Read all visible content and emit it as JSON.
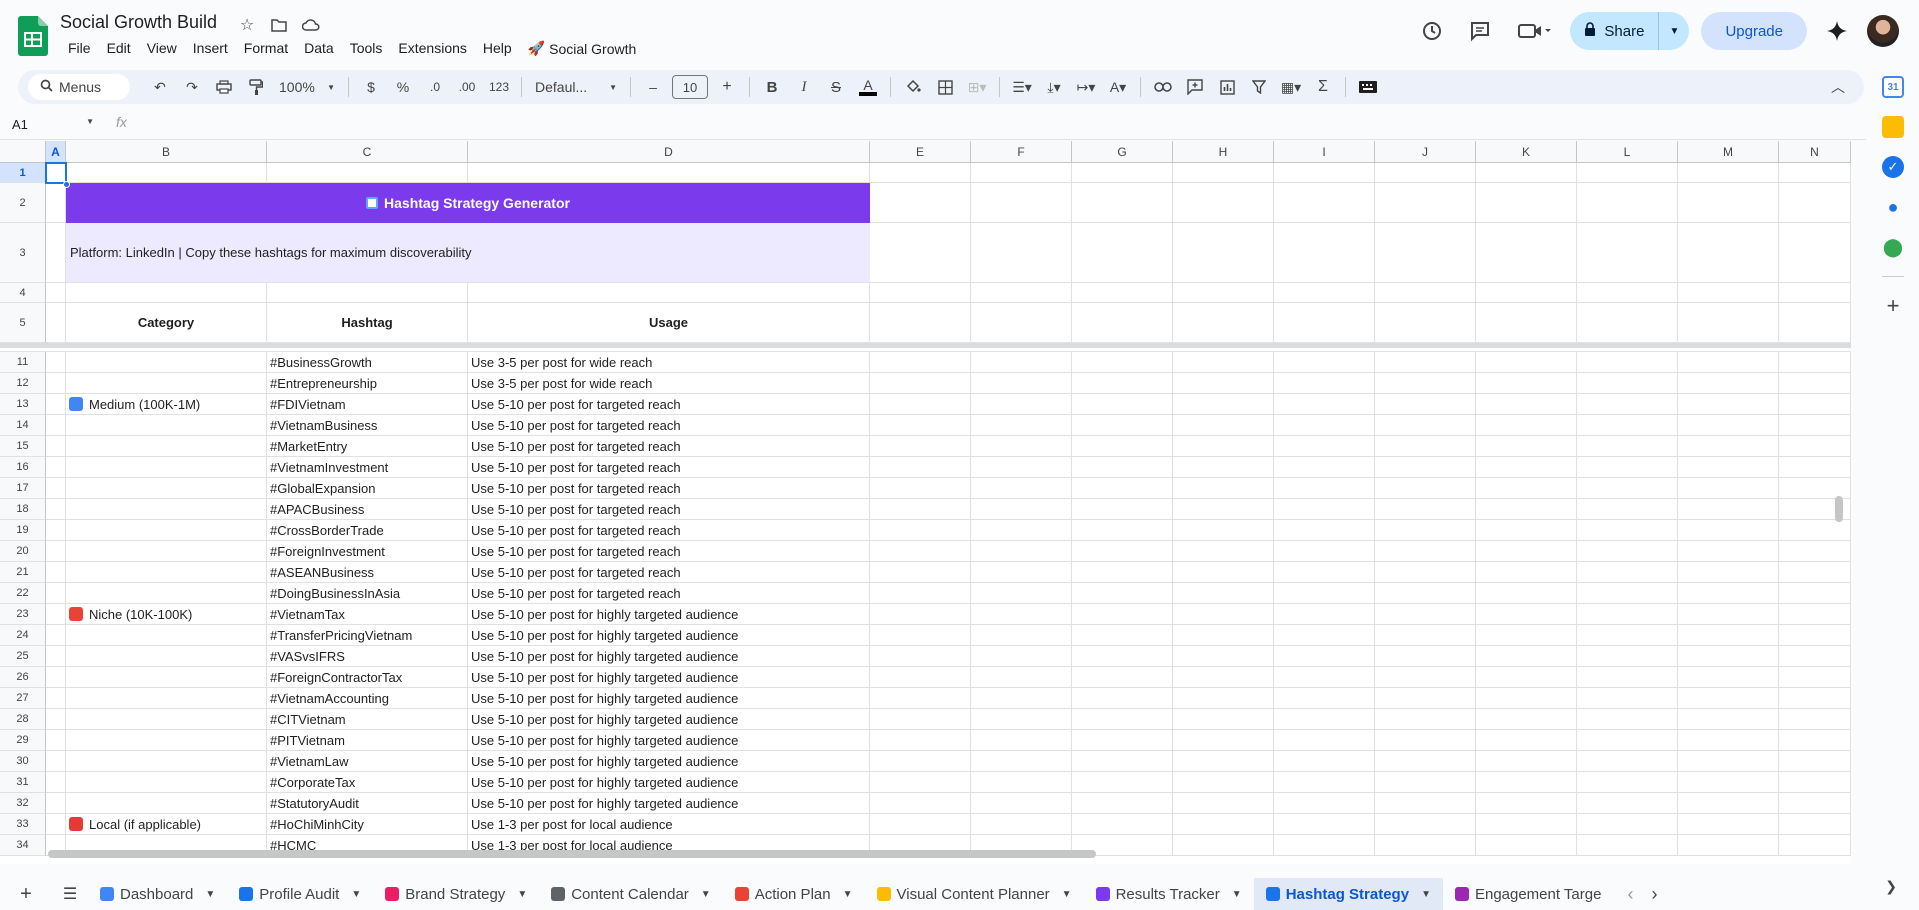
{
  "app": {
    "title": "Social Growth Build",
    "menu": [
      "File",
      "Edit",
      "View",
      "Insert",
      "Format",
      "Data",
      "Tools",
      "Extensions",
      "Help"
    ],
    "extension_menu": "Social Growth",
    "share_label": "Share",
    "upgrade_label": "Upgrade"
  },
  "toolbar": {
    "search_label": "Menus",
    "zoom": "100%",
    "currency": "$",
    "percent": "%",
    "dec_decrease": ".0",
    "dec_increase": ".00",
    "format_123": "123",
    "font": "Defaul...",
    "font_size": "10",
    "minus": "–",
    "plus": "+",
    "bold": "B",
    "italic": "I",
    "strike": "S",
    "text_color": "A",
    "sigma": "Σ"
  },
  "formula": {
    "namebox": "A1",
    "fx": "fx",
    "value": ""
  },
  "columns": [
    "A",
    "B",
    "C",
    "D",
    "E",
    "F",
    "G",
    "H",
    "I",
    "J",
    "K",
    "L",
    "M",
    "N"
  ],
  "sheet": {
    "banner": "Hashtag Strategy Generator",
    "subbanner": "Platform: LinkedIn | Copy these hashtags for maximum discoverability",
    "headers": {
      "category": "Category",
      "hashtag": "Hashtag",
      "usage": "Usage"
    },
    "top_rows": [
      "1",
      "2",
      "3",
      "4",
      "5"
    ],
    "rows": [
      {
        "n": "11",
        "cat": "",
        "tag": "#BusinessGrowth",
        "use": "Use 3-5 per post for wide reach"
      },
      {
        "n": "12",
        "cat": "",
        "tag": "#Entrepreneurship",
        "use": "Use 3-5 per post for wide reach"
      },
      {
        "n": "13",
        "cat": "Medium (100K-1M)",
        "icon": "bar-chart-icon",
        "tag": "#FDIVietnam",
        "use": "Use 5-10 per post for targeted reach"
      },
      {
        "n": "14",
        "cat": "",
        "tag": "#VietnamBusiness",
        "use": "Use 5-10 per post for targeted reach"
      },
      {
        "n": "15",
        "cat": "",
        "tag": "#MarketEntry",
        "use": "Use 5-10 per post for targeted reach"
      },
      {
        "n": "16",
        "cat": "",
        "tag": "#VietnamInvestment",
        "use": "Use 5-10 per post for targeted reach"
      },
      {
        "n": "17",
        "cat": "",
        "tag": "#GlobalExpansion",
        "use": "Use 5-10 per post for targeted reach"
      },
      {
        "n": "18",
        "cat": "",
        "tag": "#APACBusiness",
        "use": "Use 5-10 per post for targeted reach"
      },
      {
        "n": "19",
        "cat": "",
        "tag": "#CrossBorderTrade",
        "use": "Use 5-10 per post for targeted reach"
      },
      {
        "n": "20",
        "cat": "",
        "tag": "#ForeignInvestment",
        "use": "Use 5-10 per post for targeted reach"
      },
      {
        "n": "21",
        "cat": "",
        "tag": "#ASEANBusiness",
        "use": "Use 5-10 per post for targeted reach"
      },
      {
        "n": "22",
        "cat": "",
        "tag": "#DoingBusinessInAsia",
        "use": "Use 5-10 per post for targeted reach"
      },
      {
        "n": "23",
        "cat": "Niche (10K-100K)",
        "icon": "target-icon",
        "tag": "#VietnamTax",
        "use": "Use 5-10 per post for highly targeted audience"
      },
      {
        "n": "24",
        "cat": "",
        "tag": "#TransferPricingVietnam",
        "use": "Use 5-10 per post for highly targeted audience"
      },
      {
        "n": "25",
        "cat": "",
        "tag": "#VASvsIFRS",
        "use": "Use 5-10 per post for highly targeted audience"
      },
      {
        "n": "26",
        "cat": "",
        "tag": "#ForeignContractorTax",
        "use": "Use 5-10 per post for highly targeted audience"
      },
      {
        "n": "27",
        "cat": "",
        "tag": "#VietnamAccounting",
        "use": "Use 5-10 per post for highly targeted audience"
      },
      {
        "n": "28",
        "cat": "",
        "tag": "#CITVietnam",
        "use": "Use 5-10 per post for highly targeted audience"
      },
      {
        "n": "29",
        "cat": "",
        "tag": "#PITVietnam",
        "use": "Use 5-10 per post for highly targeted audience"
      },
      {
        "n": "30",
        "cat": "",
        "tag": "#VietnamLaw",
        "use": "Use 5-10 per post for highly targeted audience"
      },
      {
        "n": "31",
        "cat": "",
        "tag": "#CorporateTax",
        "use": "Use 5-10 per post for highly targeted audience"
      },
      {
        "n": "32",
        "cat": "",
        "tag": "#StatutoryAudit",
        "use": "Use 5-10 per post for highly targeted audience"
      },
      {
        "n": "33",
        "cat": "Local (if applicable)",
        "icon": "pin-icon",
        "tag": "#HoChiMinhCity",
        "use": "Use 1-3 per post for local audience"
      },
      {
        "n": "34",
        "cat": "",
        "tag": "#HCMC",
        "use": "Use 1-3 per post for local audience"
      }
    ]
  },
  "tabs": [
    {
      "label": "Dashboard",
      "color": "#4285f4",
      "active": false
    },
    {
      "label": "Profile Audit",
      "color": "#1a73e8",
      "active": false
    },
    {
      "label": "Brand Strategy",
      "color": "#e91e63",
      "active": false
    },
    {
      "label": "Content Calendar",
      "color": "#5f6368",
      "active": false
    },
    {
      "label": "Action Plan",
      "color": "#ea4335",
      "active": false
    },
    {
      "label": "Visual Content Planner",
      "color": "#fbbc04",
      "active": false
    },
    {
      "label": "Results Tracker",
      "color": "#7c3aed",
      "active": false
    },
    {
      "label": "Hashtag Strategy",
      "color": "#1a73e8",
      "active": true
    },
    {
      "label": "Engagement Targe",
      "color": "#9c27b0",
      "active": false
    }
  ],
  "colors": {
    "banner": "#7c3aed",
    "subbanner": "#ede9fe",
    "accent": "#1a73e8"
  }
}
